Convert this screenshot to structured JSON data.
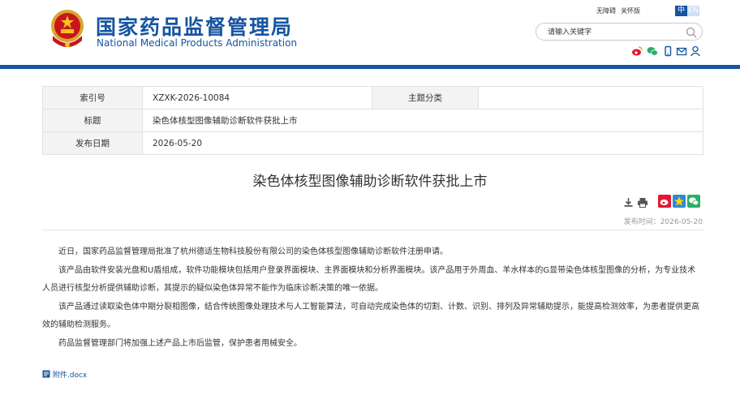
{
  "header": {
    "site_title_cn": "国家药品监督管理局",
    "site_title_en": "National Medical Products Administration",
    "top_links": [
      "无障碍",
      "关怀版"
    ],
    "lang": {
      "active": "中",
      "inactive": "EN"
    },
    "search": {
      "placeholder": "请输入关键字"
    },
    "icons": [
      "weibo-icon",
      "wechat-icon",
      "mobile-icon",
      "mail-icon",
      "user-icon"
    ],
    "accent": "#1554a2"
  },
  "meta": {
    "index_label": "索引号",
    "index_value": "XZXK-2026-10084",
    "topic_label": "主题分类",
    "topic_value": "",
    "title_label": "标题",
    "title_value": "染色体核型图像辅助诊断软件获批上市",
    "date_label": "发布日期",
    "date_value": "2026-05-20"
  },
  "article": {
    "title": "染色体核型图像辅助诊断软件获批上市",
    "published": "发布时间：2026-05-20",
    "paragraphs": [
      "近日，国家药品监督管理局批准了杭州德适生物科技股份有限公司的染色体核型图像辅助诊断软件注册申请。",
      "该产品由软件安装光盘和U盾组成，软件功能模块包括用户登录界面模块、主界面模块和分析界面模块。该产品用于外周血、羊水样本的G显带染色体核型图像的分析，为专业技术人员进行核型分析提供辅助诊断，其提示的疑似染色体异常不能作为临床诊断决策的唯一依据。",
      "该产品通过读取染色体中期分裂相图像，结合传统图像处理技术与人工智能算法，可自动完成染色体的切割、计数、识别、排列及异常辅助提示，能提高检测效率，为患者提供更高效的辅助检测服务。",
      "药品监督管理部门将加强上述产品上市后监管，保护患者用械安全。"
    ],
    "attachment": "附件.docx"
  }
}
